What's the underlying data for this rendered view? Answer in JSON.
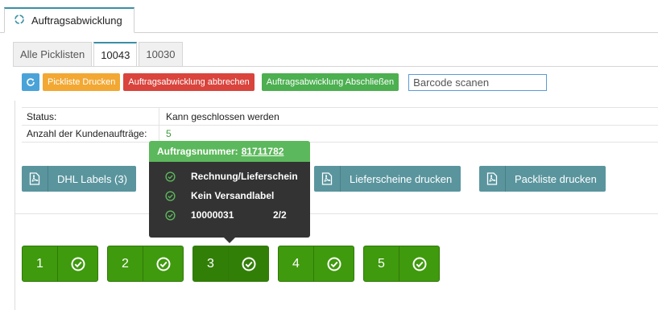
{
  "window": {
    "tab_title": "Auftragsabwicklung"
  },
  "tabs": [
    "Alle Picklisten",
    "10043",
    "10030"
  ],
  "toolbar": {
    "print_picklist": "Pickliste Drucken",
    "abort": "Auftragsabwicklung abbrechen",
    "complete": "Auftragsabwicklung Abschließen",
    "barcode_placeholder": "Barcode scanen"
  },
  "info": {
    "status_label": "Status:",
    "status_value": "Kann geschlossen werden",
    "count_label": "Anzahl der Kundenaufträge:",
    "count_value": "5"
  },
  "print_buttons": {
    "dhl": "DHL Labels (3)",
    "delivery_notes": "Lieferscheine drucken",
    "packlist": "Packliste drucken"
  },
  "tooltip": {
    "header_label": "Auftragsnummer:",
    "order_number": "81711782",
    "rows": [
      {
        "text": "Rechnung/Lieferschein",
        "count": ""
      },
      {
        "text": "Kein Versandlabel",
        "count": ""
      },
      {
        "text": "10000031",
        "count": "2/2"
      }
    ]
  },
  "orders": [
    "1",
    "2",
    "3",
    "4",
    "5"
  ],
  "colors": {
    "accent": "#3a8fa5",
    "success": "#4caf50",
    "danger": "#d9443d",
    "warning": "#f2a833",
    "order_green": "#3f9a0d",
    "print_button": "#5a959e"
  },
  "icons": {
    "tab": "refresh-circle-icon",
    "refresh": "refresh-icon",
    "pdf": "pdf-file-icon",
    "check": "check-circle-icon"
  }
}
